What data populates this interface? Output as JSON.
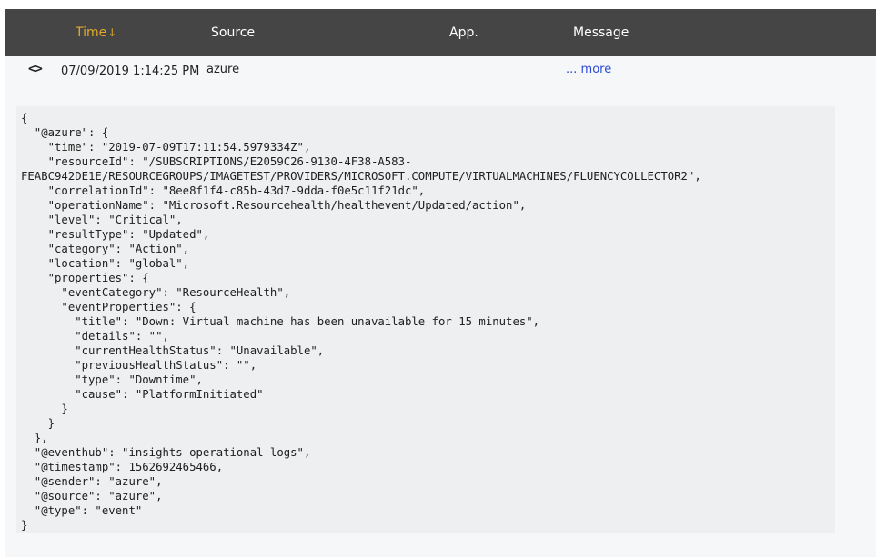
{
  "header": {
    "time_label": "Time",
    "sort_icon": "arrow-down-icon",
    "source_label": "Source",
    "app_label": "App.",
    "message_label": "Message",
    "accent_color": "#e0a82e",
    "background_color": "#454545"
  },
  "row": {
    "toggle_glyph": "<>",
    "toggle_icon": "code-brackets-icon",
    "time": "07/09/2019 1:14:25 PM",
    "source": "azure",
    "app": "",
    "more_label": "... more",
    "json_text": "{\n  \"@azure\": {\n    \"time\": \"2019-07-09T17:11:54.5979334Z\",\n    \"resourceId\": \"/SUBSCRIPTIONS/E2059C26-9130-4F38-A583-\nFEABC942DE1E/RESOURCEGROUPS/IMAGETEST/PROVIDERS/MICROSOFT.COMPUTE/VIRTUALMACHINES/FLUENCYCOLLECTOR2\",\n    \"correlationId\": \"8ee8f1f4-c85b-43d7-9dda-f0e5c11f21dc\",\n    \"operationName\": \"Microsoft.Resourcehealth/healthevent/Updated/action\",\n    \"level\": \"Critical\",\n    \"resultType\": \"Updated\",\n    \"category\": \"Action\",\n    \"location\": \"global\",\n    \"properties\": {\n      \"eventCategory\": \"ResourceHealth\",\n      \"eventProperties\": {\n        \"title\": \"Down: Virtual machine has been unavailable for 15 minutes\",\n        \"details\": \"\",\n        \"currentHealthStatus\": \"Unavailable\",\n        \"previousHealthStatus\": \"\",\n        \"type\": \"Downtime\",\n        \"cause\": \"PlatformInitiated\"\n      }\n    }\n  },\n  \"@eventhub\": \"insights-operational-logs\",\n  \"@timestamp\": 1562692465466,\n  \"@sender\": \"azure\",\n  \"@source\": \"azure\",\n  \"@type\": \"event\"\n}"
  }
}
